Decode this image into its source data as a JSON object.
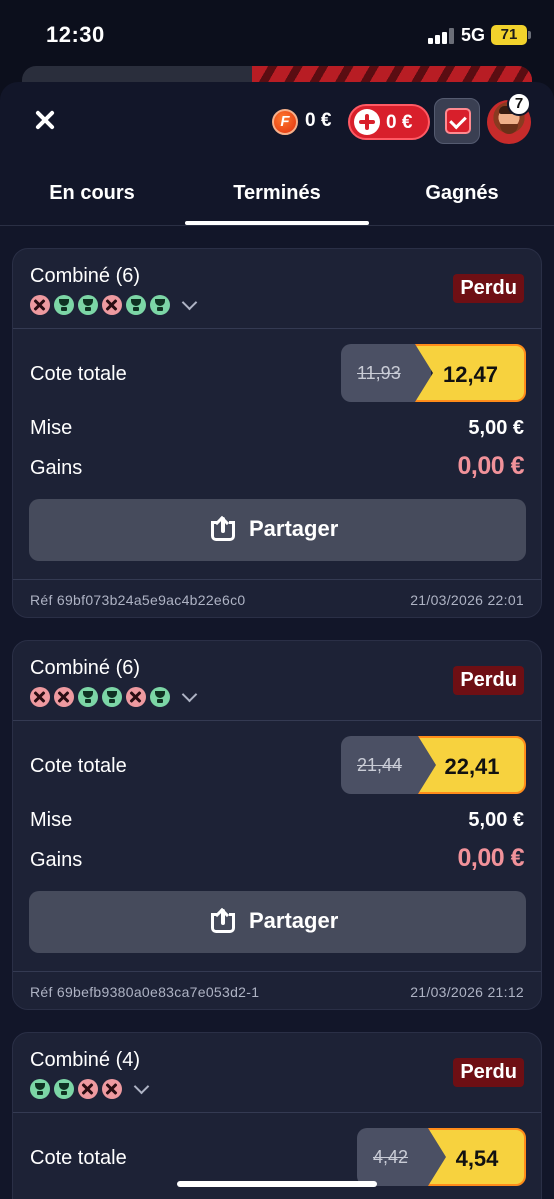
{
  "status_bar": {
    "time": "12:30",
    "network": "5G",
    "battery": "71"
  },
  "header": {
    "fcoin_letter": "F",
    "fcoin_balance": "0 €",
    "bonus_balance": "0 €",
    "notifications_count": "7"
  },
  "tabs": [
    {
      "label": "En cours",
      "active": false
    },
    {
      "label": "Terminés",
      "active": true
    },
    {
      "label": "Gagnés",
      "active": false
    }
  ],
  "labels": {
    "total_odds": "Cote totale",
    "stake": "Mise",
    "winnings": "Gains",
    "share": "Partager",
    "ref_prefix": "Réf"
  },
  "bets": [
    {
      "title": "Combiné (6)",
      "legs": [
        "lost",
        "won",
        "won",
        "lost",
        "won",
        "won"
      ],
      "status": "Perdu",
      "odds_old": "11,93",
      "odds_new": "12,47",
      "stake": "5,00 €",
      "gains": "0,00 €",
      "ref": "Réf 69bf073b24a5e9ac4b22e6c0",
      "date": "21/03/2026 22:01"
    },
    {
      "title": "Combiné (6)",
      "legs": [
        "lost",
        "lost",
        "won",
        "won",
        "lost",
        "won"
      ],
      "status": "Perdu",
      "odds_old": "21,44",
      "odds_new": "22,41",
      "stake": "5,00 €",
      "gains": "0,00 €",
      "ref": "Réf 69befb9380a0e83ca7e053d2-1",
      "date": "21/03/2026 21:12"
    },
    {
      "title": "Combiné (4)",
      "legs": [
        "won",
        "won",
        "lost",
        "lost"
      ],
      "status": "Perdu",
      "odds_old": "4,42",
      "odds_new": "4,54"
    }
  ],
  "colors": {
    "background": "#0c0f1c",
    "sheet": "#121629",
    "card": "#1d2236",
    "lost_badge": "#6e0f14",
    "gain_zero": "#f1929a",
    "boosted_odds": "#f7d23e",
    "leg_won": "#7cd6a6",
    "leg_lost": "#ee9aa0"
  },
  "icons": [
    "close-icon",
    "fcoin-icon",
    "plus-icon",
    "betslip-check-icon",
    "avatar",
    "leg-lost-icon",
    "leg-won-icon",
    "chevron-down-icon",
    "share-icon"
  ]
}
